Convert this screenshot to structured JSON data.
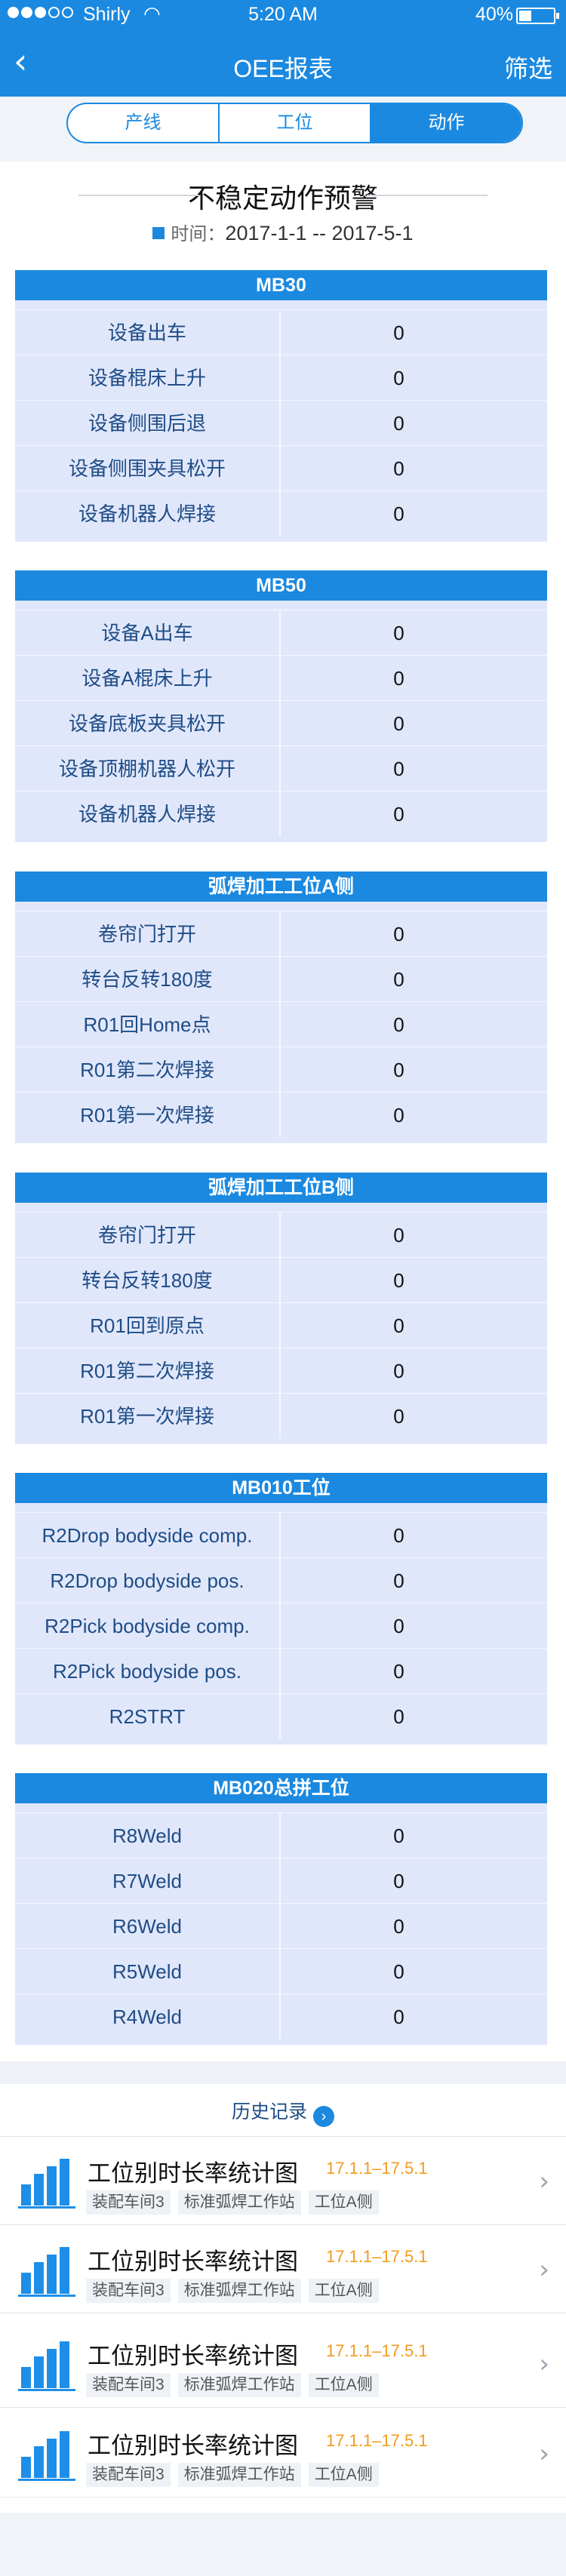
{
  "status": {
    "carrier": "Shirly",
    "time": "5:20 AM",
    "battery": "40%"
  },
  "nav": {
    "back_icon": "chevron-left-icon",
    "title": "OEE报表",
    "filter": "筛选"
  },
  "tabs": [
    {
      "label": "产线",
      "active": false
    },
    {
      "label": "工位",
      "active": false
    },
    {
      "label": "动作",
      "active": true
    }
  ],
  "heading": {
    "title": "不稳定动作预警",
    "date_label": "时间：",
    "date_range": "2017-1-1 -- 2017-5-1"
  },
  "tables": [
    {
      "name": "MB30",
      "rows": [
        {
          "label": "设备出车",
          "value": "0"
        },
        {
          "label": "设备棍床上升",
          "value": "0"
        },
        {
          "label": "设备侧围后退",
          "value": "0"
        },
        {
          "label": "设备侧围夹具松开",
          "value": "0"
        },
        {
          "label": "设备机器人焊接",
          "value": "0"
        }
      ]
    },
    {
      "name": "MB50",
      "rows": [
        {
          "label": "设备A出车",
          "value": "0"
        },
        {
          "label": "设备A棍床上升",
          "value": "0"
        },
        {
          "label": "设备底板夹具松开",
          "value": "0"
        },
        {
          "label": "设备顶棚机器人松开",
          "value": "0"
        },
        {
          "label": "设备机器人焊接",
          "value": "0"
        }
      ]
    },
    {
      "name": "弧焊加工工位A侧",
      "rows": [
        {
          "label": "卷帘门打开",
          "value": "0"
        },
        {
          "label": "转台反转180度",
          "value": "0"
        },
        {
          "label": "R01回Home点",
          "value": "0"
        },
        {
          "label": "R01第二次焊接",
          "value": "0"
        },
        {
          "label": "R01第一次焊接",
          "value": "0"
        }
      ]
    },
    {
      "name": "弧焊加工工位B侧",
      "rows": [
        {
          "label": "卷帘门打开",
          "value": "0"
        },
        {
          "label": "转台反转180度",
          "value": "0"
        },
        {
          "label": "R01回到原点",
          "value": "0"
        },
        {
          "label": "R01第二次焊接",
          "value": "0"
        },
        {
          "label": "R01第一次焊接",
          "value": "0"
        }
      ]
    },
    {
      "name": "MB010工位",
      "rows": [
        {
          "label": "R2Drop bodyside comp.",
          "value": "0"
        },
        {
          "label": "R2Drop bodyside pos.",
          "value": "0"
        },
        {
          "label": "R2Pick bodyside comp.",
          "value": "0"
        },
        {
          "label": "R2Pick bodyside pos.",
          "value": "0"
        },
        {
          "label": "R2STRT",
          "value": "0"
        }
      ]
    },
    {
      "name": "MB020总拼工位",
      "rows": [
        {
          "label": "R8Weld",
          "value": "0"
        },
        {
          "label": "R7Weld",
          "value": "0"
        },
        {
          "label": "R6Weld",
          "value": "0"
        },
        {
          "label": "R5Weld",
          "value": "0"
        },
        {
          "label": "R4Weld",
          "value": "0"
        }
      ]
    }
  ],
  "history": {
    "label": "历史记录"
  },
  "records": [
    {
      "title": "工位别时长率统计图",
      "date": "17.1.1–17.5.1",
      "tags": [
        "装配车间3",
        "标准弧焊工作站",
        "工位A侧"
      ]
    },
    {
      "title": "工位别时长率统计图",
      "date": "17.1.1–17.5.1",
      "tags": [
        "装配车间3",
        "标准弧焊工作站",
        "工位A侧"
      ]
    },
    {
      "title": "工位别时长率统计图",
      "date": "17.1.1–17.5.1",
      "tags": [
        "装配车间3",
        "标准弧焊工作站",
        "工位A侧"
      ]
    },
    {
      "title": "工位别时长率统计图",
      "date": "17.1.1–17.5.1",
      "tags": [
        "装配车间3",
        "标准弧焊工作站",
        "工位A侧"
      ]
    }
  ],
  "colors": {
    "primary": "#1b89e0",
    "row_bg": "#e1e7fb",
    "date_accent": "#f29a1d"
  }
}
